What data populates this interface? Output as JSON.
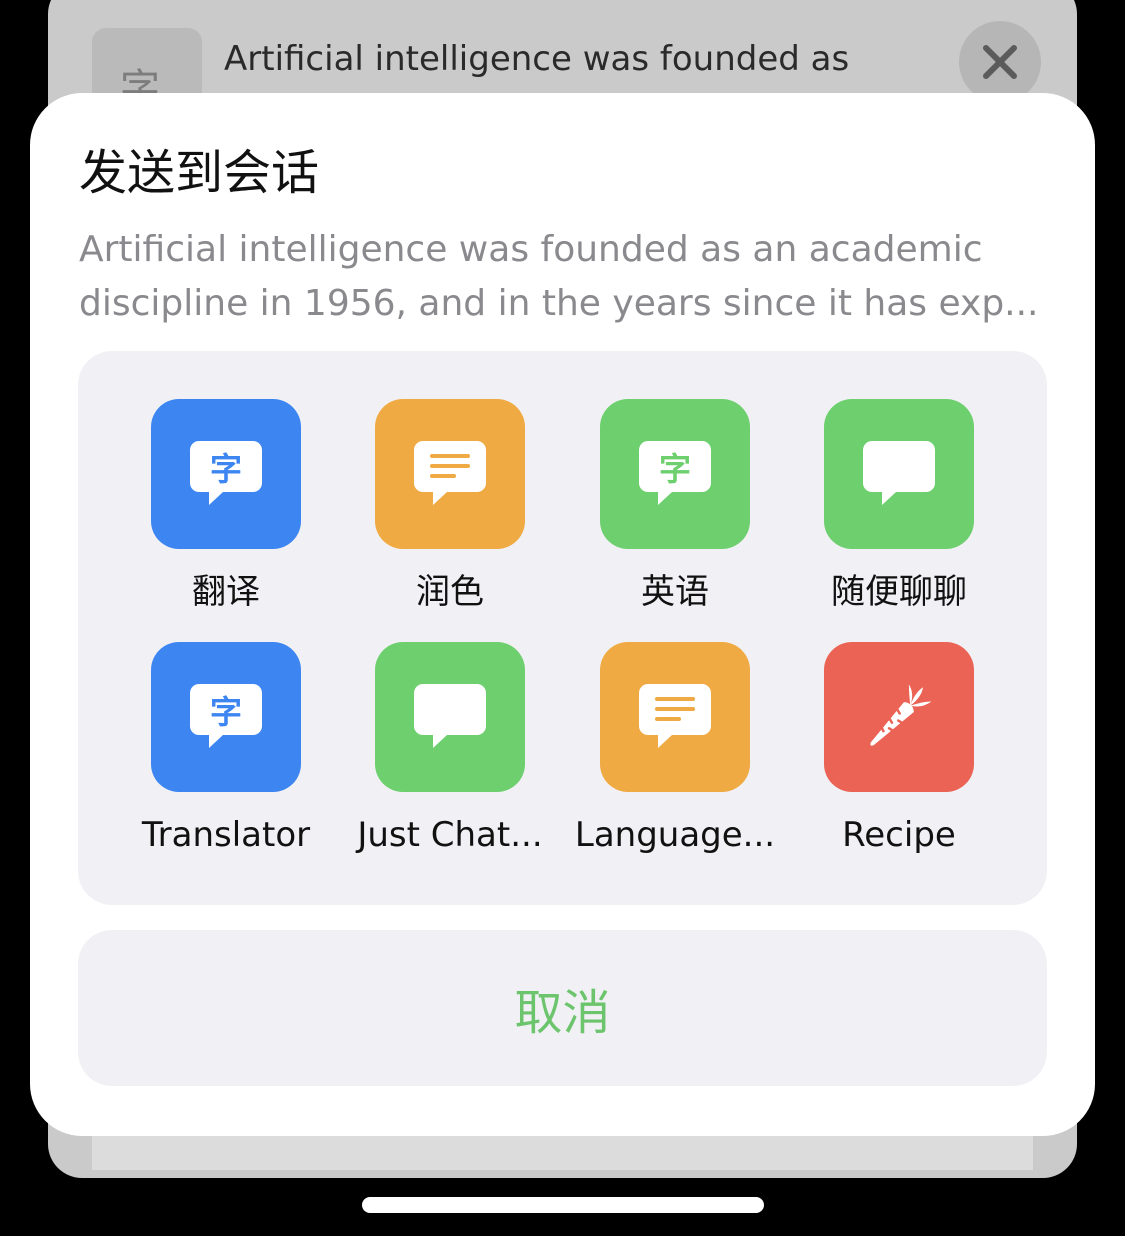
{
  "background": {
    "thumb_glyph": "字",
    "preview_line": "Artificial intelligence was founded as",
    "close_icon": "close-icon"
  },
  "sheet": {
    "title": "发送到会话",
    "preview_line1": "Artificial intelligence was founded as an academic",
    "preview_line2": "discipline in 1956, and in the years since it has exp..."
  },
  "apps": [
    {
      "label": "翻译",
      "color": "#3d86f1",
      "icon": "translate-bubble-icon"
    },
    {
      "label": "润色",
      "color": "#f0aa43",
      "icon": "text-lines-bubble-icon"
    },
    {
      "label": "英语",
      "color": "#6dcf6e",
      "icon": "translate-bubble-icon"
    },
    {
      "label": "随便聊聊",
      "color": "#6dcf6e",
      "icon": "chat-bubble-icon"
    },
    {
      "label": "Translator",
      "color": "#3d86f1",
      "icon": "translate-bubble-icon"
    },
    {
      "label": "Just Chat...",
      "color": "#6dcf6e",
      "icon": "chat-bubble-icon"
    },
    {
      "label": "Language...",
      "color": "#f0aa43",
      "icon": "text-lines-bubble-icon"
    },
    {
      "label": "Recipe",
      "color": "#ea6354",
      "icon": "carrot-icon"
    }
  ],
  "bubble_glyph": "字",
  "cancel_label": "取消",
  "colors": {
    "accent_green": "#6cc46c",
    "grid_bg": "#f1f1f5"
  }
}
